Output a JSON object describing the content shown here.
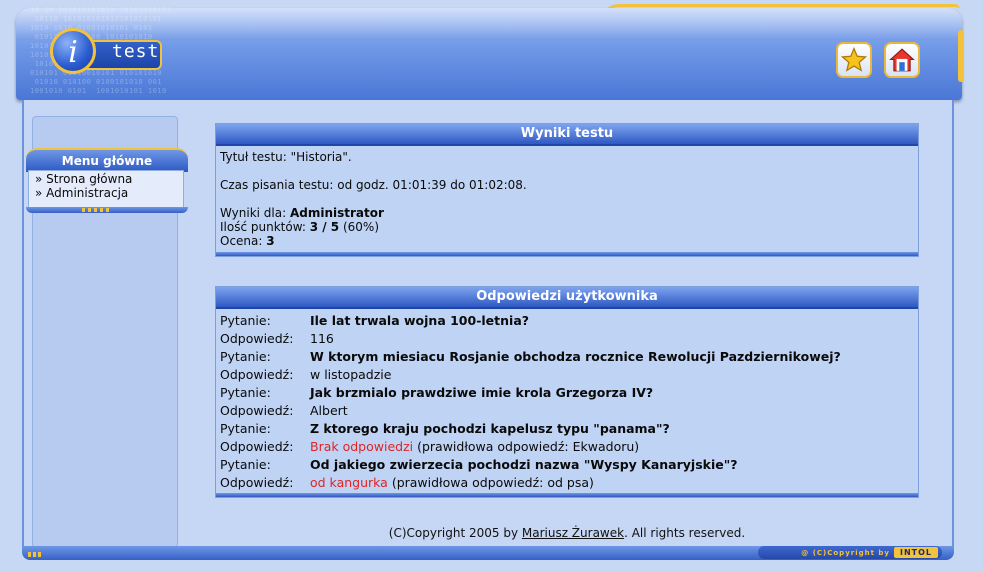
{
  "header": {
    "logo_letter": "i",
    "logo_text": "test",
    "binary_decoration": "10 10 101010101010 10101010101\n 10110 101010101010101010101\n1010 1010 01001010101 0101\n 0101010 010100 1010101010\n1010101010 01010 010101010\n101010 010 1010101 10101010\n 101010101 10101010 101 1\n010101 01010010101 010101010\n 01010 010100 0100101010 001\n1001010 0101  1001010101 1010",
    "buttons": [
      {
        "name": "favorites-button",
        "icon": "star-icon"
      },
      {
        "name": "home-button",
        "icon": "home-icon"
      }
    ]
  },
  "sidebar": {
    "menu_title": "Menu główne",
    "items": [
      {
        "label": "» Strona główna"
      },
      {
        "label": "» Administracja"
      }
    ]
  },
  "results": {
    "title": "Wyniki testu",
    "test_title_line": "Tytuł testu: \"Historia\".",
    "time_line": "Czas pisania testu: od godz. 01:01:39 do 01:02:08.",
    "results_for_label": "Wyniki dla: ",
    "results_for_value": "Administrator",
    "points_label": "Ilość punktów: ",
    "points_value": "3 / 5",
    "points_percent": " (60%)",
    "grade_label": "Ocena: ",
    "grade_value": "3"
  },
  "answers": {
    "title": "Odpowiedzi użytkownika",
    "question_label": "Pytanie:",
    "answer_label": "Odpowiedź:",
    "items": [
      {
        "question": "Ile lat trwala wojna 100-letnia?",
        "answer": "116",
        "correct_answer": ""
      },
      {
        "question": "W ktorym miesiacu Rosjanie obchodza rocznice Rewolucji Pazdziernikowej?",
        "answer": "w listopadzie",
        "correct_answer": ""
      },
      {
        "question": "Jak brzmialo prawdziwe imie krola Grzegorza IV?",
        "answer": "Albert",
        "correct_answer": ""
      },
      {
        "question": "Z ktorego kraju pochodzi kapelusz typu \"panama\"?",
        "answer": "Brak odpowiedzi",
        "correct_answer": " (prawidłowa odpowiedź: Ekwadoru)"
      },
      {
        "question": "Od jakiego zwierzecia pochodzi nazwa \"Wyspy Kanaryjskie\"?",
        "answer": "od kangurka",
        "correct_answer": " (prawidłowa odpowiedź: od psa)"
      }
    ]
  },
  "footer": {
    "copyright_prefix": "(C)Copyright 2005 by ",
    "author": "Mariusz Żurawek",
    "copyright_suffix": ". All rights reserved.",
    "badge_text": "@ (C)Copyright by",
    "badge_brand": "INTOL"
  },
  "colors": {
    "accent_yellow": "#f2c23b",
    "header_blue": "#4a77d6",
    "wrong_answer": "#e02424"
  }
}
